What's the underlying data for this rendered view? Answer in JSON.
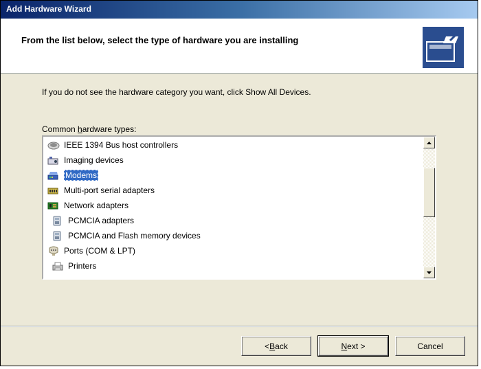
{
  "window": {
    "title": "Add Hardware Wizard"
  },
  "header": {
    "heading": "From the list below, select the type of hardware you are installing",
    "icon": "hardware-wizard-icon"
  },
  "content": {
    "instruction": "If you do not see the hardware category you want, click Show All Devices.",
    "list_label_prefix": "Common ",
    "list_label_ukey": "h",
    "list_label_suffix": "ardware types:"
  },
  "hardware_types": [
    {
      "label": "IEEE 1394 Bus host controllers",
      "icon": "ieee1394-icon",
      "selected": false,
      "indent": false
    },
    {
      "label": "Imaging devices",
      "icon": "imaging-icon",
      "selected": false,
      "indent": false
    },
    {
      "label": "Modems",
      "icon": "modem-icon",
      "selected": true,
      "indent": false
    },
    {
      "label": "Multi-port serial adapters",
      "icon": "multiport-icon",
      "selected": false,
      "indent": false
    },
    {
      "label": "Network adapters",
      "icon": "network-adapter-icon",
      "selected": false,
      "indent": false
    },
    {
      "label": "PCMCIA adapters",
      "icon": "pcmcia-icon",
      "selected": false,
      "indent": true
    },
    {
      "label": "PCMCIA and Flash memory devices",
      "icon": "pcmcia-flash-icon",
      "selected": false,
      "indent": true
    },
    {
      "label": "Ports (COM & LPT)",
      "icon": "ports-icon",
      "selected": false,
      "indent": false
    },
    {
      "label": "Printers",
      "icon": "printers-icon",
      "selected": false,
      "indent": true
    }
  ],
  "buttons": {
    "back_prefix": "< ",
    "back_ukey": "B",
    "back_suffix": "ack",
    "next_ukey": "N",
    "next_suffix": "ext >",
    "cancel": "Cancel"
  },
  "colors": {
    "selection": "#316ac5",
    "dialog_bg": "#ece9d8",
    "titlebar_start": "#0a246a"
  }
}
